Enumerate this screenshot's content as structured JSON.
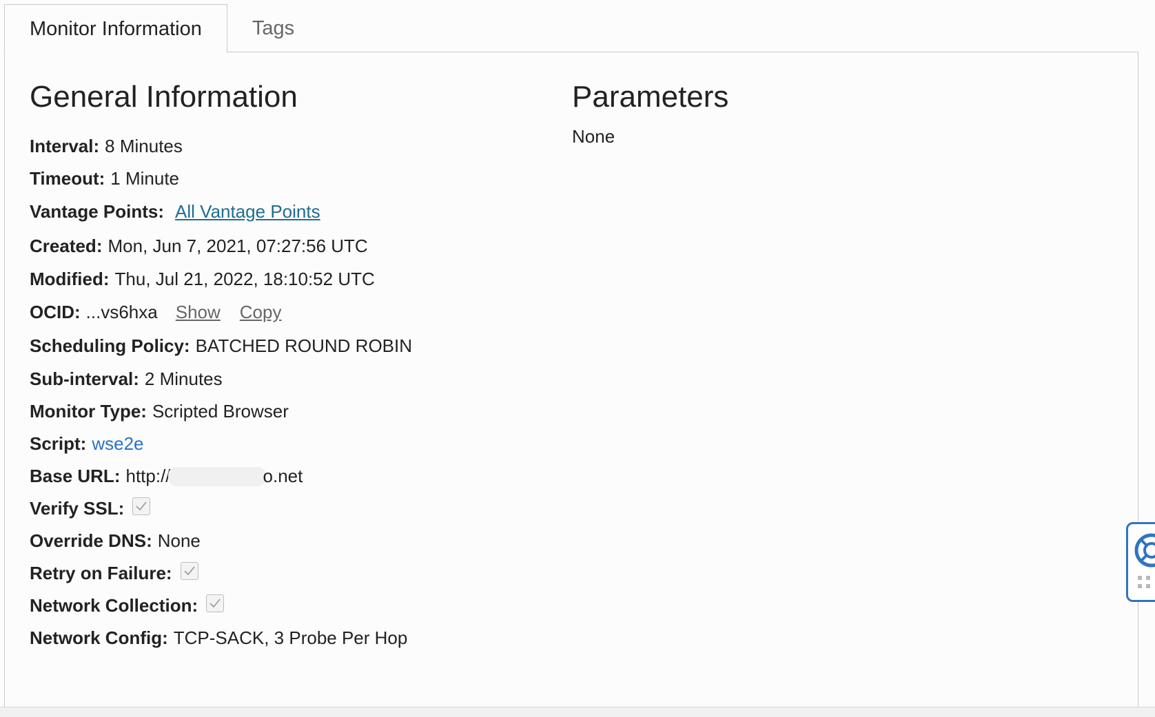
{
  "tabs": [
    {
      "label": "Monitor Information",
      "active": true
    },
    {
      "label": "Tags",
      "active": false
    }
  ],
  "general": {
    "title": "General Information",
    "interval": {
      "label": "Interval:",
      "value": "8 Minutes"
    },
    "timeout": {
      "label": "Timeout:",
      "value": "1 Minute"
    },
    "vantage_points": {
      "label": "Vantage Points:",
      "link": "All Vantage Points"
    },
    "created": {
      "label": "Created:",
      "value": "Mon, Jun 7, 2021, 07:27:56 UTC"
    },
    "modified": {
      "label": "Modified:",
      "value": "Thu, Jul 21, 2022, 18:10:52 UTC"
    },
    "ocid": {
      "label": "OCID:",
      "value": "...vs6hxa",
      "show": "Show",
      "copy": "Copy"
    },
    "scheduling_policy": {
      "label": "Scheduling Policy:",
      "value": "BATCHED ROUND ROBIN"
    },
    "sub_interval": {
      "label": "Sub-interval:",
      "value": "2 Minutes"
    },
    "monitor_type": {
      "label": "Monitor Type:",
      "value": "Scripted Browser"
    },
    "script": {
      "label": "Script:",
      "link": "wse2e"
    },
    "base_url": {
      "label": "Base URL:",
      "prefix": "http://",
      "suffix": "o.net"
    },
    "verify_ssl": {
      "label": "Verify SSL:",
      "checked": true
    },
    "override_dns": {
      "label": "Override DNS:",
      "value": "None"
    },
    "retry_on_failure": {
      "label": "Retry on Failure:",
      "checked": true
    },
    "network_collection": {
      "label": "Network Collection:",
      "checked": true
    },
    "network_config": {
      "label": "Network Config:",
      "value": "TCP-SACK, 3 Probe Per Hop"
    }
  },
  "parameters": {
    "title": "Parameters",
    "value": "None"
  },
  "colors": {
    "link_teal": "#1f6d8f",
    "link_blue": "#2a72c8",
    "help_widget_border": "#2f74c0"
  },
  "icons": {
    "help_widget": "lifebuoy-icon",
    "checkbox": "checkmark-icon"
  }
}
